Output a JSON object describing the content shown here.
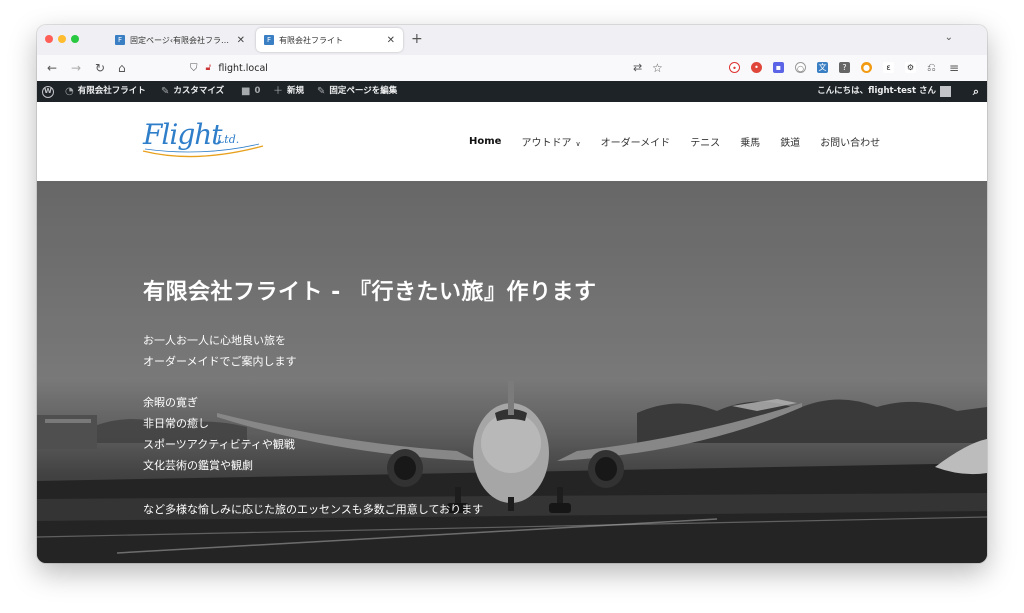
{
  "tabs": [
    {
      "label": "固定ページ‹有限会社フライト — WordPress",
      "favicon": "flight-favicon"
    },
    {
      "label": "有限会社フライト",
      "favicon": "flight-favicon"
    }
  ],
  "browser": {
    "url": "flight.local",
    "icons": [
      "back-icon",
      "forward-icon",
      "reload-icon",
      "home-icon",
      "shield-icon",
      "lock-icon",
      "translate-icon",
      "bookmark-star-icon",
      "pocket-icon",
      "extension-icons",
      "menu-icon"
    ]
  },
  "adminbar": {
    "site_name": "有限会社フライト",
    "customize": "カスタマイズ",
    "comments_count": "0",
    "new": "新規",
    "edit_page": "固定ページを編集",
    "greeting": "こんにちは、flight-test さん"
  },
  "site": {
    "logo_main": "Flight",
    "logo_sub": "Ltd.",
    "menu": [
      "Home",
      "アウトドア",
      "オーダーメイド",
      "テニス",
      "乗馬",
      "鉄道",
      "お問い合わせ"
    ]
  },
  "hero": {
    "title": "有限会社フライト - 『行きたい旅』作ります",
    "intro_lines": [
      "お一人お一人に心地良い旅を",
      "オーダーメイドでご案内します"
    ],
    "features": [
      "余暇の寛ぎ",
      "非日常の癒し",
      "スポーツアクティビティや観戦",
      "文化芸術の鑑賞や観劇"
    ],
    "closing": "など多様な愉しみに応じた旅のエッセンスも多数ご用意しております"
  },
  "colors": {
    "admin_bar": "#1d2327",
    "logo_blue": "#2f7ec9",
    "logo_swoosh": "#e8a11d",
    "hero_text": "#ffffff"
  }
}
